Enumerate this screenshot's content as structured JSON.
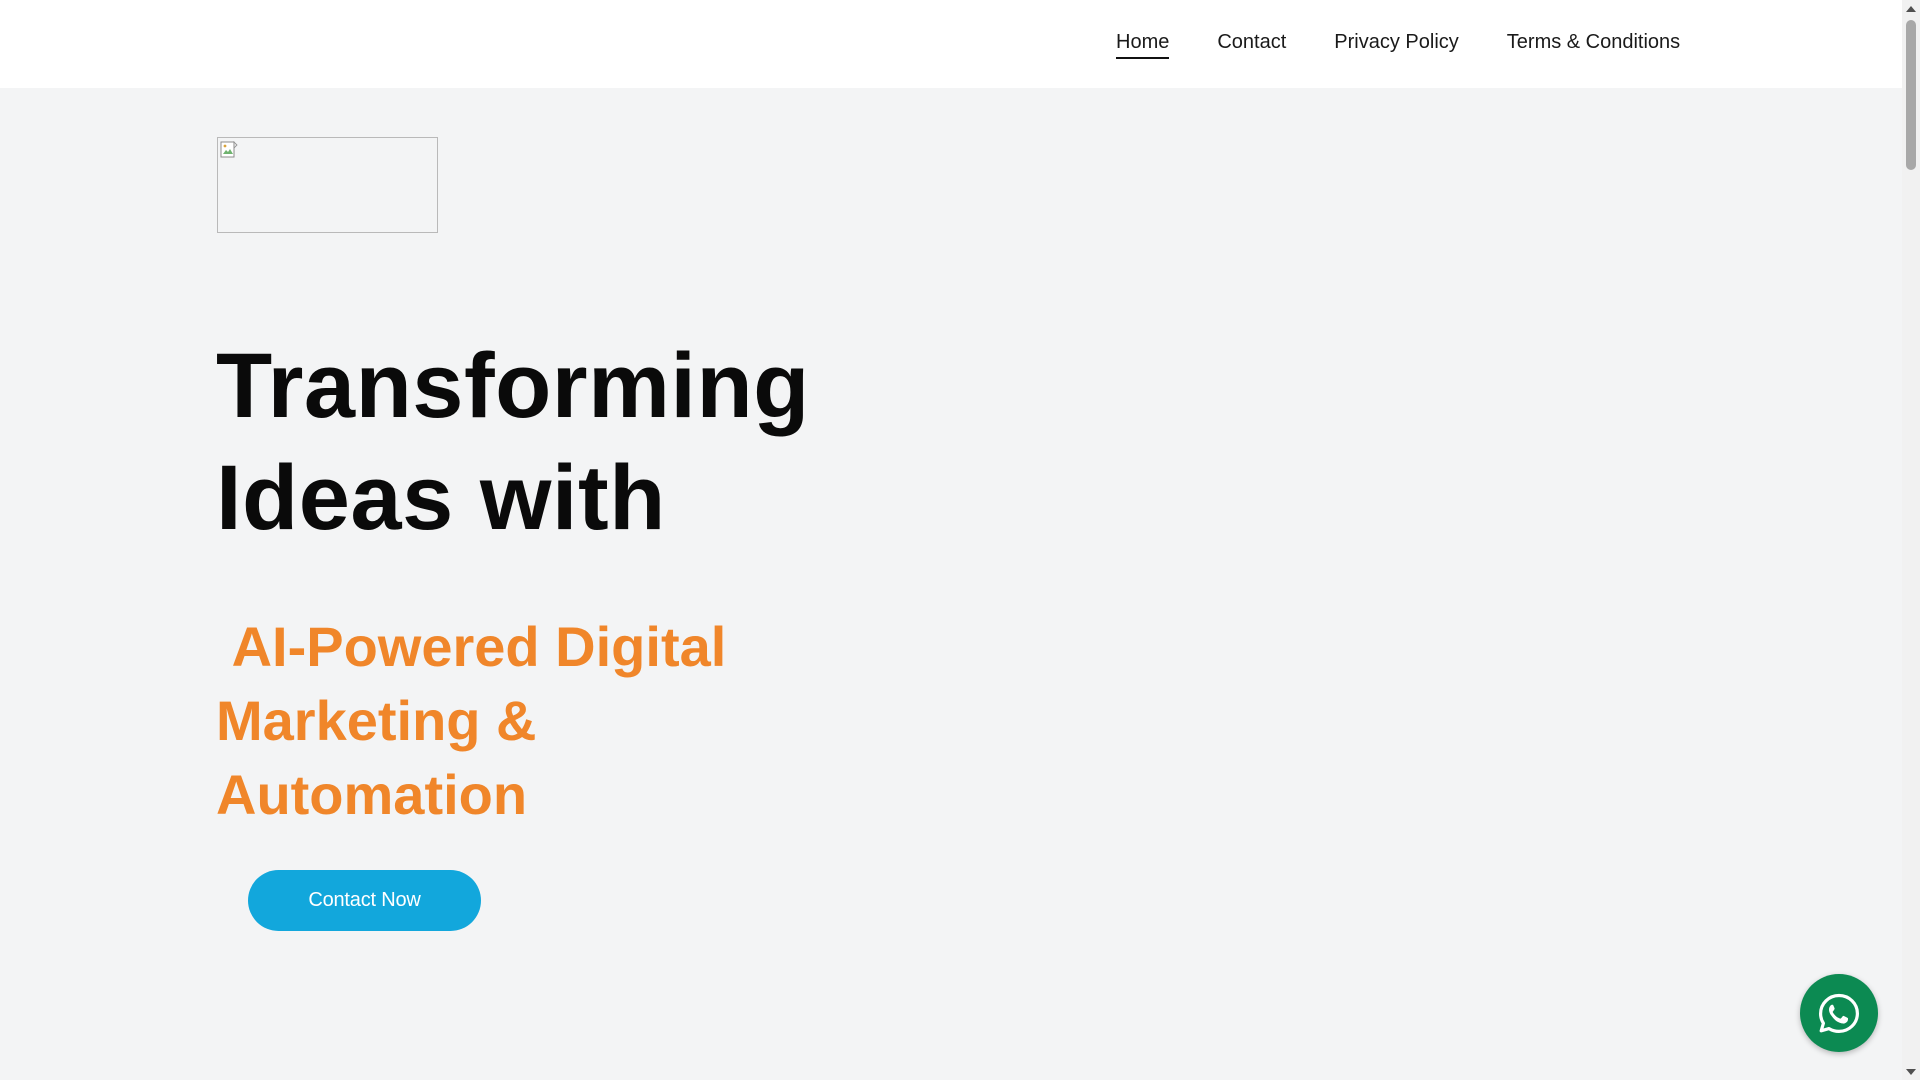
{
  "header": {
    "nav": [
      {
        "label": "Home",
        "active": true
      },
      {
        "label": "Contact",
        "active": false
      },
      {
        "label": "Privacy Policy",
        "active": false
      },
      {
        "label": "Terms & Conditions",
        "active": false
      }
    ]
  },
  "hero": {
    "title": "Transforming Ideas with",
    "subtitle": " AI-Powered Digital Marketing & Automation",
    "cta_label": "Contact Now"
  },
  "icons": {
    "logo": "broken-image-icon",
    "floating": "whatsapp-icon",
    "scroll_up": "triangle-up-icon",
    "scroll_down": "triangle-down-icon"
  },
  "colors": {
    "background": "#f3f4f5",
    "header": "#ffffff",
    "title": "#0a0a0a",
    "accent_orange": "#f0862a",
    "cta_blue": "#12a7dc",
    "whatsapp_green": "#0c8a52"
  }
}
